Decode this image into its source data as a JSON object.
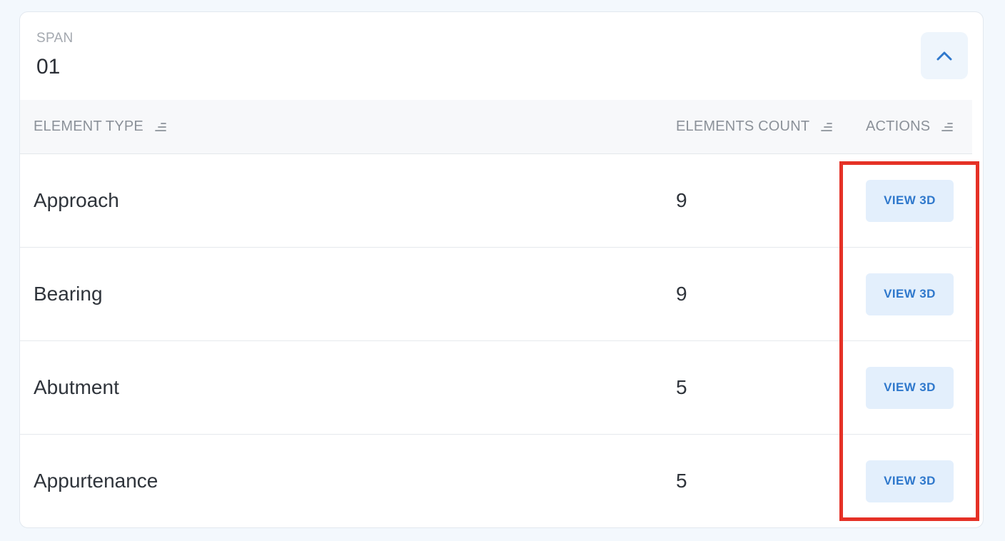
{
  "span": {
    "label": "SPAN",
    "value": "01"
  },
  "collapse_icon": "chevron-up-icon",
  "table": {
    "columns": [
      {
        "key": "type",
        "label": "ELEMENT TYPE",
        "sort_icon": "sort-icon"
      },
      {
        "key": "count",
        "label": "ELEMENTS COUNT",
        "sort_icon": "sort-icon"
      },
      {
        "key": "actions",
        "label": "ACTIONS",
        "sort_icon": "sort-icon"
      }
    ],
    "rows": [
      {
        "type": "Approach",
        "count": "9",
        "action_label": "VIEW 3D"
      },
      {
        "type": "Bearing",
        "count": "9",
        "action_label": "VIEW 3D"
      },
      {
        "type": "Abutment",
        "count": "5",
        "action_label": "VIEW 3D"
      },
      {
        "type": "Appurtenance",
        "count": "5",
        "action_label": "VIEW 3D"
      }
    ]
  },
  "colors": {
    "accent": "#2f78cc",
    "button_bg": "#e3effc",
    "highlight": "#e53126"
  }
}
